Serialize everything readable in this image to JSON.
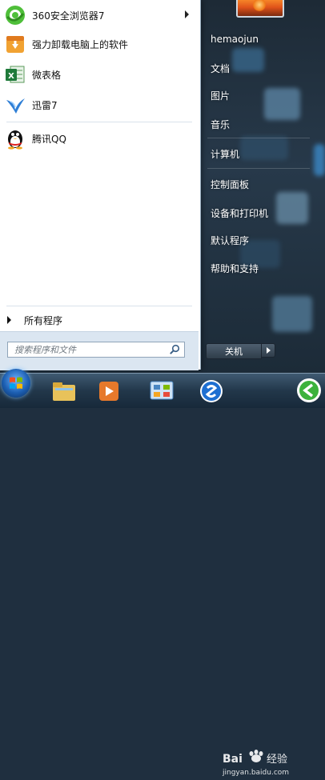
{
  "programs": [
    {
      "label": "360安全浏览器7",
      "icon": "360-browser-icon",
      "has_submenu": true
    },
    {
      "label": "强力卸载电脑上的软件",
      "icon": "uninstaller-icon",
      "has_submenu": false
    },
    {
      "label": "微表格",
      "icon": "spreadsheet-icon",
      "has_submenu": false
    },
    {
      "label": "迅雷7",
      "icon": "thunder-bird-icon",
      "has_submenu": false
    },
    {
      "label": "腾讯QQ",
      "icon": "qq-penguin-icon",
      "has_submenu": false
    }
  ],
  "all_programs_label": "所有程序",
  "search": {
    "placeholder": "搜索程序和文件"
  },
  "right": {
    "username": "hemaojun",
    "items": [
      "文档",
      "图片",
      "音乐",
      "计算机",
      "控制面板",
      "设备和打印机",
      "默认程序",
      "帮助和支持"
    ]
  },
  "shutdown_label": "关机",
  "watermark": {
    "brand": "Bai",
    "brand2": "经验",
    "url": "jingyan.baidu.com"
  },
  "colors": {
    "menu_bg": "#ffffff",
    "right_bg": "#1f2f3f",
    "accent_green": "#3cb23c"
  }
}
